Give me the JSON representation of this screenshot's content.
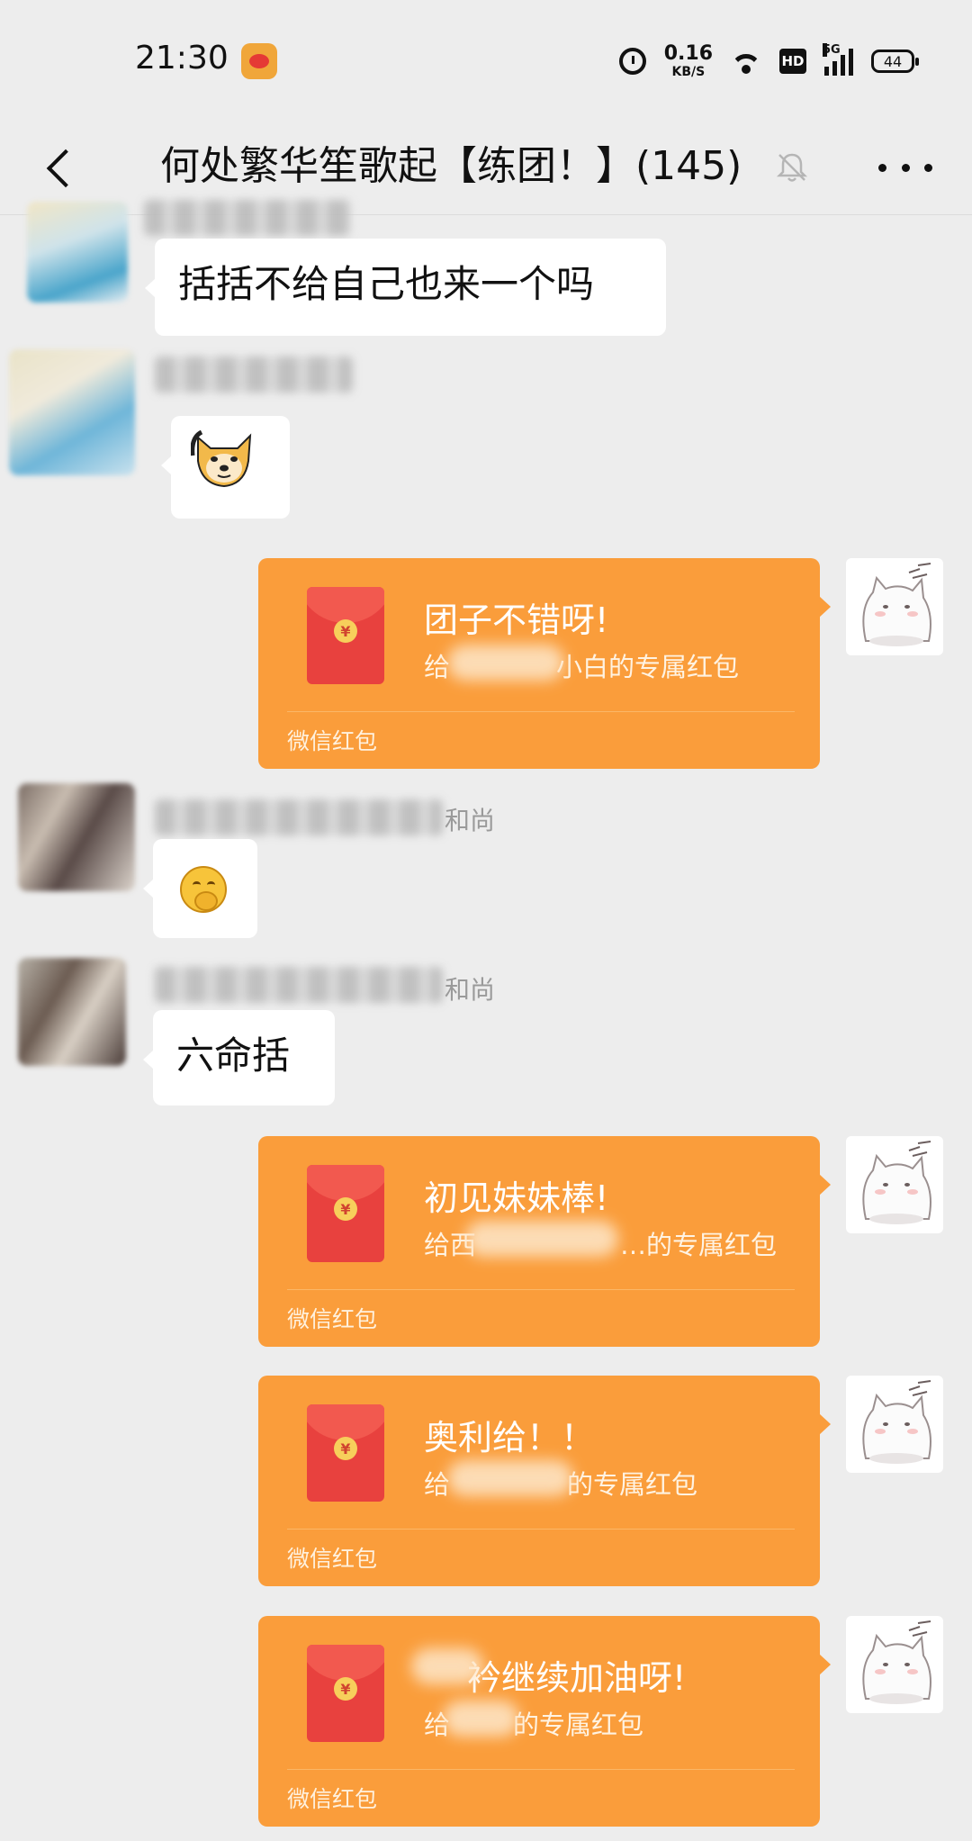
{
  "status_bar": {
    "time": "21:30",
    "speed_value": "0.16",
    "speed_unit": "KB/S",
    "hd_label": "HD",
    "network_label": "5G",
    "battery": "44"
  },
  "nav": {
    "title": "何处繁华笙歌起【练团！】(145)"
  },
  "messages": [
    {
      "type": "text",
      "text": "括括不给自己也来一个吗"
    },
    {
      "type": "sticker",
      "sticker": "doge-sticker"
    },
    {
      "type": "red_packet",
      "title": "团子不错呀!",
      "subtitle_prefix": "给",
      "subtitle_suffix": "小白的专属红包",
      "footer": "微信红包"
    },
    {
      "type": "emoji",
      "name_suffix": "和尚",
      "emoji": "hmm-emoji"
    },
    {
      "type": "text",
      "name_suffix": "和尚",
      "text": "六命括"
    },
    {
      "type": "red_packet",
      "title": "初见妹妹棒!",
      "subtitle_prefix": "给西",
      "subtitle_suffix": "…的专属红包",
      "footer": "微信红包"
    },
    {
      "type": "red_packet",
      "title": "奥利给！！",
      "subtitle_prefix": "给",
      "subtitle_suffix": "的专属红包",
      "footer": "微信红包"
    },
    {
      "type": "red_packet",
      "title": "衿继续加油呀!",
      "subtitle_prefix": "给",
      "subtitle_suffix": "的专属红包",
      "footer": "微信红包"
    }
  ],
  "colors": {
    "background": "#ededed",
    "red_packet": "#fa9d3b",
    "envelope": "#e8413e",
    "bubble": "#ffffff"
  }
}
